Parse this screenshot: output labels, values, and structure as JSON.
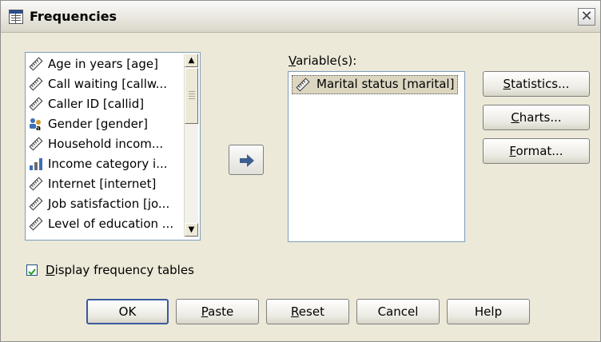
{
  "window": {
    "title": "Frequencies"
  },
  "source_list": {
    "items": [
      {
        "label": "Age in years [age]",
        "icon": "scale-ruler-icon"
      },
      {
        "label": "Call waiting [callw...",
        "icon": "scale-ruler-icon"
      },
      {
        "label": "Caller ID [callid]",
        "icon": "scale-ruler-icon"
      },
      {
        "label": "Gender [gender]",
        "icon": "nominal-people-icon"
      },
      {
        "label": "Household incom...",
        "icon": "scale-ruler-icon"
      },
      {
        "label": "Income category i...",
        "icon": "ordinal-bars-icon"
      },
      {
        "label": "Internet [internet]",
        "icon": "scale-ruler-icon"
      },
      {
        "label": "Job satisfaction [jo...",
        "icon": "scale-ruler-icon"
      },
      {
        "label": "Level of education ...",
        "icon": "scale-ruler-icon"
      }
    ]
  },
  "move_button": {
    "icon": "right-arrow-icon"
  },
  "target_list": {
    "label_pre": "",
    "label_accel": "V",
    "label_post": "ariable(s):",
    "items": [
      {
        "label": "Marital status [marital]",
        "icon": "scale-ruler-icon"
      }
    ]
  },
  "side_buttons": {
    "statistics": {
      "accel": "S",
      "rest": "tatistics..."
    },
    "charts": {
      "accel": "C",
      "rest": "harts..."
    },
    "format": {
      "accel": "F",
      "rest": "ormat..."
    }
  },
  "display_tables": {
    "accel": "D",
    "rest": "isplay frequency tables",
    "checked": true
  },
  "bottom_buttons": {
    "ok": "OK",
    "paste": {
      "accel": "P",
      "rest": "aste"
    },
    "reset": {
      "accel": "R",
      "rest": "eset"
    },
    "cancel": "Cancel",
    "help": "Help"
  },
  "colors": {
    "list_border": "#7f9db9",
    "selection": "#dcd6c1",
    "default_button": "#3a5a9c"
  }
}
